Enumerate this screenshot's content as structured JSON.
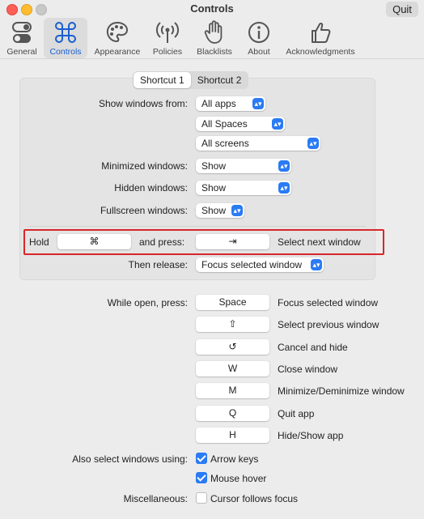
{
  "window": {
    "title": "Controls",
    "quit_label": "Quit"
  },
  "tabs": [
    {
      "label": "General",
      "icon": "toggle-icon"
    },
    {
      "label": "Controls",
      "icon": "command-icon"
    },
    {
      "label": "Appearance",
      "icon": "palette-icon"
    },
    {
      "label": "Policies",
      "icon": "antenna-icon"
    },
    {
      "label": "Blacklists",
      "icon": "hand-icon"
    },
    {
      "label": "About",
      "icon": "info-icon"
    },
    {
      "label": "Acknowledgments",
      "icon": "thumbs-up-icon"
    }
  ],
  "shortcut_tabs": [
    "Shortcut 1",
    "Shortcut 2"
  ],
  "show_windows": {
    "label": "Show windows from:",
    "apps": "All apps",
    "spaces": "All Spaces",
    "screens": "All screens"
  },
  "minimized": {
    "label": "Minimized windows:",
    "value": "Show"
  },
  "hidden": {
    "label": "Hidden windows:",
    "value": "Show"
  },
  "fullscreen": {
    "label": "Fullscreen windows:",
    "value": "Show"
  },
  "hold": {
    "label": "Hold",
    "key": "⌘",
    "and_press": "and press:",
    "press_key": "⇥",
    "action": "Select next window"
  },
  "then_release": {
    "label": "Then release:",
    "value": "Focus selected window"
  },
  "while_open": {
    "label": "While open, press:",
    "rows": [
      {
        "key": "Space",
        "action": "Focus selected window"
      },
      {
        "key": "⇧",
        "action": "Select previous window"
      },
      {
        "key": "↺",
        "action": "Cancel and hide"
      },
      {
        "key": "W",
        "action": "Close window"
      },
      {
        "key": "M",
        "action": "Minimize/Deminimize window"
      },
      {
        "key": "Q",
        "action": "Quit app"
      },
      {
        "key": "H",
        "action": "Hide/Show app"
      }
    ]
  },
  "also_select": {
    "label": "Also select windows using:",
    "options": [
      {
        "label": "Arrow keys",
        "checked": true
      },
      {
        "label": "Mouse hover",
        "checked": true
      }
    ]
  },
  "misc": {
    "label": "Miscellaneous:",
    "option": {
      "label": "Cursor follows focus",
      "checked": false
    }
  },
  "colors": {
    "accent": "#2a7bf5",
    "highlight": "#d8262a"
  }
}
